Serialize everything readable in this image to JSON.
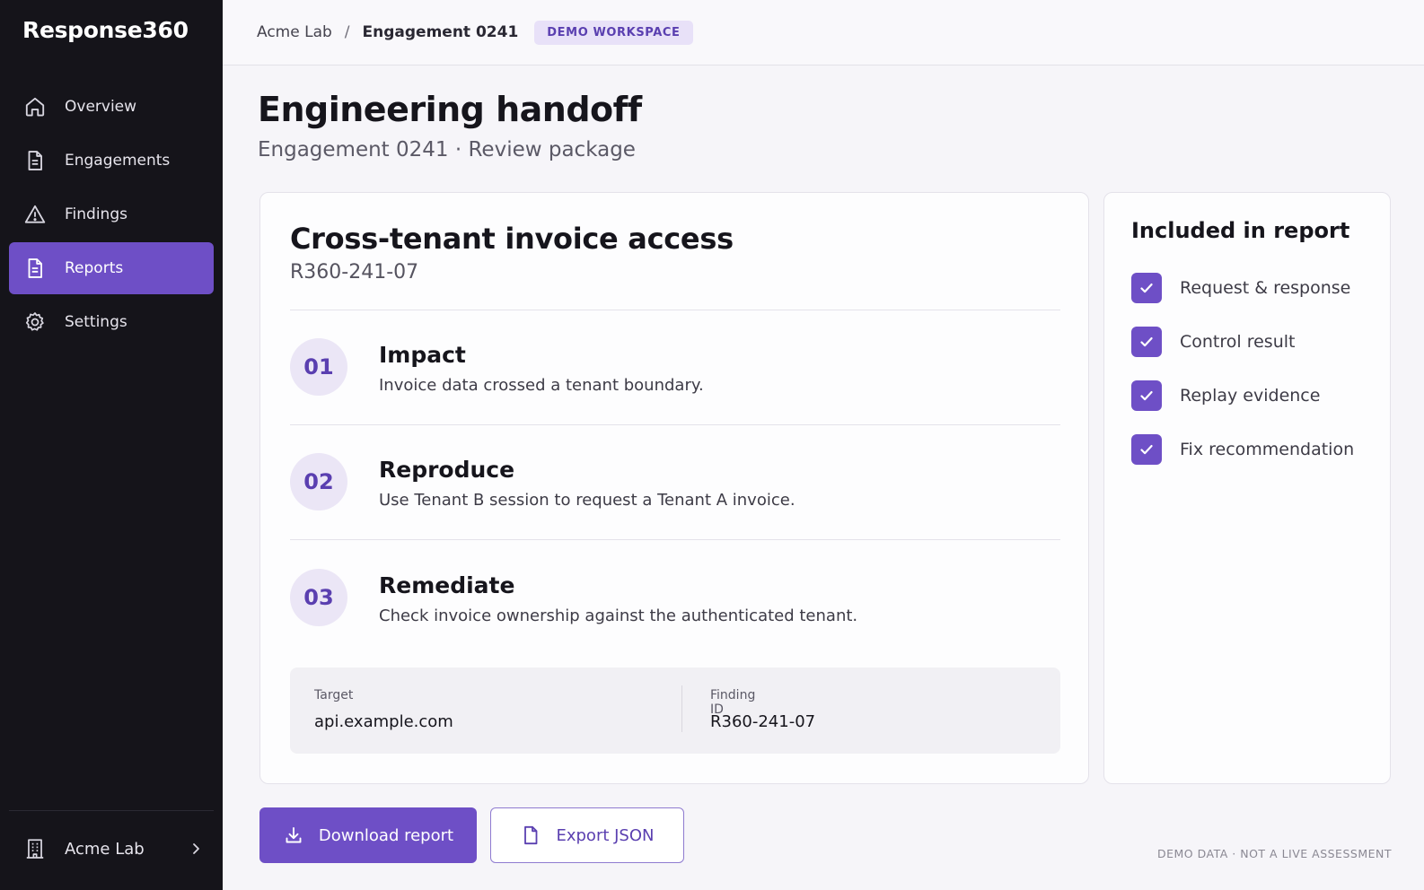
{
  "brand": {
    "name": "Response360"
  },
  "sidebar": {
    "items": [
      {
        "label": "Overview",
        "icon": "home-icon",
        "active": false
      },
      {
        "label": "Engagements",
        "icon": "document-icon",
        "active": false
      },
      {
        "label": "Findings",
        "icon": "warning-icon",
        "active": false
      },
      {
        "label": "Reports",
        "icon": "report-icon",
        "active": true
      },
      {
        "label": "Settings",
        "icon": "gear-icon",
        "active": false
      }
    ],
    "org": {
      "label": "Acme Lab",
      "icon": "building-icon"
    }
  },
  "topbar": {
    "breadcrumb": [
      "Acme Lab",
      "Engagement 0241"
    ],
    "separator": "/",
    "badge": "DEMO WORKSPACE"
  },
  "header": {
    "title": "Engineering handoff",
    "subtitle": "Engagement 0241 · Review package"
  },
  "finding": {
    "title": "Cross-tenant invoice access",
    "id": "R360-241-07",
    "steps": [
      {
        "num": "01",
        "title": "Impact",
        "desc": "Invoice data crossed a tenant boundary."
      },
      {
        "num": "02",
        "title": "Reproduce",
        "desc": "Use Tenant B session to request a Tenant A invoice."
      },
      {
        "num": "03",
        "title": "Remediate",
        "desc": "Check invoice ownership against the authenticated tenant."
      }
    ],
    "meta": {
      "target_label": "Target",
      "target_value": "api.example.com",
      "finding_id_label": "Finding ID",
      "finding_id_value": "R360-241-07"
    }
  },
  "report_contents": {
    "title": "Included in report",
    "items": [
      {
        "label": "Request & response",
        "checked": true
      },
      {
        "label": "Control result",
        "checked": true
      },
      {
        "label": "Replay evidence",
        "checked": true
      },
      {
        "label": "Fix recommendation",
        "checked": true
      }
    ]
  },
  "actions": {
    "download_label": "Download report",
    "export_label": "Export JSON"
  },
  "footnote": "DEMO DATA · NOT A LIVE ASSESSMENT",
  "colors": {
    "accent": "#6e4fc6",
    "sidebar_bg": "#15141a",
    "badge_bg": "#e8e1f8"
  }
}
